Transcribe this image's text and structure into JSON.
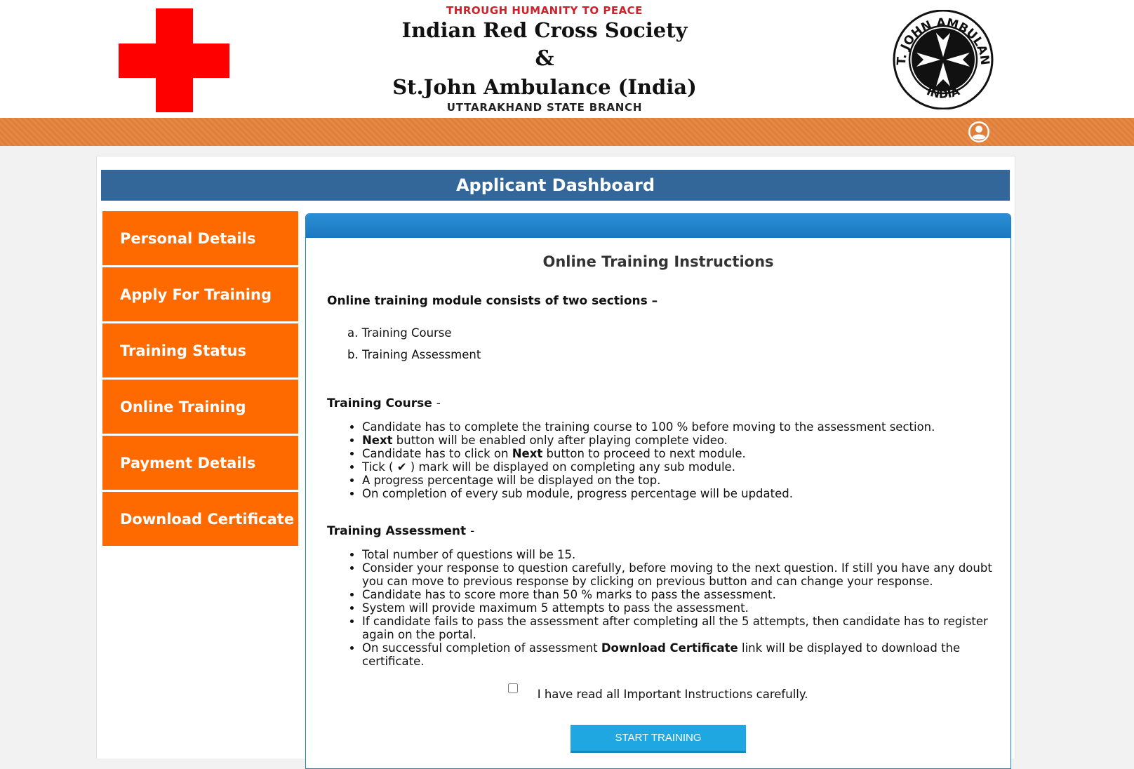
{
  "header": {
    "motto": "THROUGH HUMANITY TO PEACE",
    "org_line1": "Indian Red Cross Society",
    "ampersand": "&",
    "org_line2": "St.John Ambulance (India)",
    "branch": "UTTARAKHAND STATE BRANCH",
    "logo_text_top": "ST. JOHN AMBULANS",
    "logo_text_bottom": "INDIA",
    "user_icon": "user-circle-icon"
  },
  "dashboard": {
    "title": "Applicant Dashboard"
  },
  "sidebar": {
    "items": [
      {
        "label": "Personal Details"
      },
      {
        "label": "Apply For Training"
      },
      {
        "label": "Training Status"
      },
      {
        "label": "Online Training"
      },
      {
        "label": "Payment Details"
      },
      {
        "label": "Download Certificate"
      }
    ]
  },
  "instructions": {
    "title": "Online Training Instructions",
    "lead": "Online training module consists of two sections –",
    "sections": [
      "a. Training Course",
      "b. Training Assessment"
    ],
    "course": {
      "title": "Training Course",
      "dash": "-",
      "items": {
        "c1": "Candidate has to complete the training course to 100 % before moving to the assessment section.",
        "c2_bold": "Next",
        "c2_rest": " button will be enabled only after playing complete video.",
        "c3_pre": "Candidate has to click on ",
        "c3_bold": "Next",
        "c3_post": " button to proceed to next module.",
        "c4": "Tick ( ✔ ) mark will be displayed on completing any sub module.",
        "c5": "A progress percentage will be displayed on the top.",
        "c6": "On completion of every sub module, progress percentage will be updated."
      }
    },
    "assessment": {
      "title": "Training Assessment",
      "dash": "-",
      "items": {
        "a1": "Total number of questions will be 15.",
        "a2": "Consider your response to question carefully, before moving to the next question. If still you have any doubt you can move to previous response by clicking on previous button and can change your response.",
        "a3": "Candidate has to score more than 50 % marks to pass the assessment.",
        "a4": "System will provide maximum 5 attempts to pass the assessment.",
        "a5": "If candidate fails to pass the assessment after completing all the 5 attempts, then candidate has to register again on the portal.",
        "a6_pre": "On successful completion of assessment ",
        "a6_bold": "Download Certificate",
        "a6_post": " link will be displayed to download the certificate."
      }
    },
    "agree_label": "I have read all Important Instructions carefully.",
    "agree_checked": false,
    "start_button": "START TRAINING"
  },
  "colors": {
    "red_cross": "#ff0000",
    "band": "#e07f3a",
    "dashboard_bar": "#336699",
    "sidebar": "#ff6a00",
    "card_head": "#1f7fc4",
    "button": "#1ea7e0"
  }
}
